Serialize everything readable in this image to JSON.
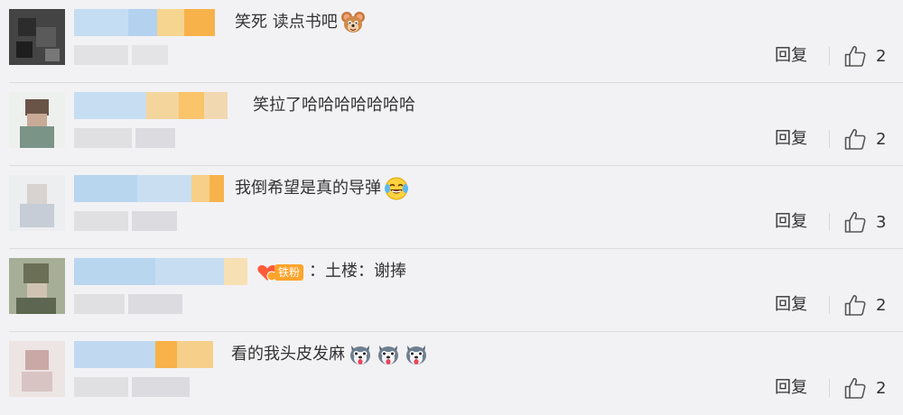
{
  "comments": [
    {
      "text": "笑死 读点书吧",
      "reply_label": "回复",
      "likes": "2",
      "emoji": "jerry-mouse-emoji"
    },
    {
      "text": "笑拉了哈哈哈哈哈哈哈",
      "reply_label": "回复",
      "likes": "2"
    },
    {
      "text": "我倒希望是真的导弹",
      "reply_label": "回复",
      "likes": "3",
      "emoji": "laughing-crying-emoji"
    },
    {
      "text": "：土楼：谢捧",
      "reply_label": "回复",
      "likes": "2",
      "badge": "铁粉"
    },
    {
      "text": "看的我头皮发麻",
      "reply_label": "回复",
      "likes": "2",
      "emoji": "husky-dog-emoji"
    }
  ],
  "colors": {
    "background": "#f2f2f5",
    "text": "#333333",
    "badge": "#ffa42b",
    "blurred_name_blue": "#b9d6ef",
    "blurred_name_orange": "#f8b24a"
  }
}
